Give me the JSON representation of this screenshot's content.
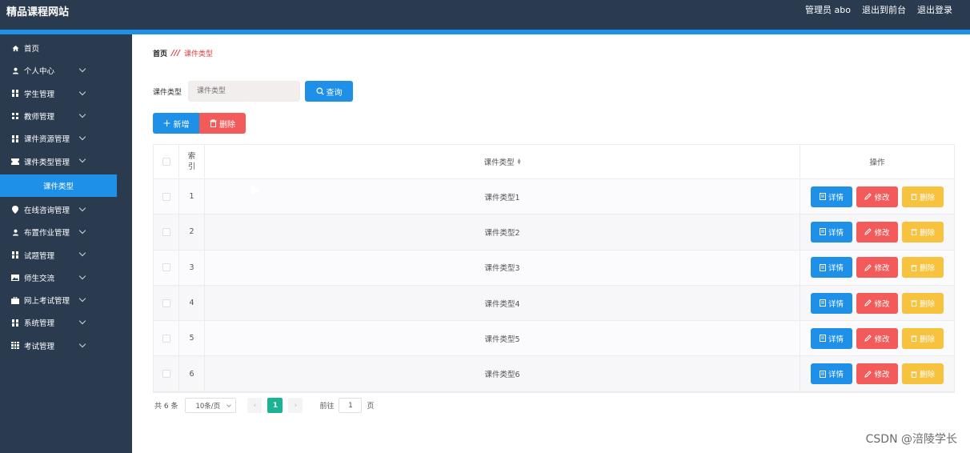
{
  "header": {
    "site_title": "精品课程网站",
    "admin_label": "管理员 abo",
    "to_front": "退出到前台",
    "logout": "退出登录"
  },
  "sidebar": {
    "items": [
      {
        "label": "首页",
        "icon": "home-icon",
        "has_children": false
      },
      {
        "label": "个人中心",
        "icon": "user-icon",
        "has_children": true
      },
      {
        "label": "学生管理",
        "icon": "grid-icon",
        "has_children": true
      },
      {
        "label": "教师管理",
        "icon": "grid-icon",
        "has_children": true
      },
      {
        "label": "课件资源管理",
        "icon": "grid-icon",
        "has_children": true
      },
      {
        "label": "课件类型管理",
        "icon": "ticket-icon",
        "has_children": true
      }
    ],
    "active_sub": "课件类型",
    "items_after": [
      {
        "label": "在线咨询管理",
        "icon": "location-pin-icon"
      },
      {
        "label": "布置作业管理",
        "icon": "user-icon"
      },
      {
        "label": "试题管理",
        "icon": "grid-icon"
      },
      {
        "label": "师生交流",
        "icon": "image-icon"
      },
      {
        "label": "网上考试管理",
        "icon": "briefcase-icon"
      },
      {
        "label": "系统管理",
        "icon": "grid-icon"
      },
      {
        "label": "考试管理",
        "icon": "grid9-icon"
      }
    ]
  },
  "breadcrumb": {
    "home": "首页",
    "separator": "///",
    "current": "课件类型"
  },
  "search": {
    "label": "课件类型",
    "placeholder": "课件类型",
    "query_button": "查询"
  },
  "actions": {
    "add_button": "新增",
    "delete_button": "删除"
  },
  "table": {
    "headers": {
      "index": "索引",
      "type": "课件类型",
      "ops": "操作"
    },
    "rows": [
      {
        "index": "1",
        "type": "课件类型1"
      },
      {
        "index": "2",
        "type": "课件类型2"
      },
      {
        "index": "3",
        "type": "课件类型3"
      },
      {
        "index": "4",
        "type": "课件类型4"
      },
      {
        "index": "5",
        "type": "课件类型5"
      },
      {
        "index": "6",
        "type": "课件类型6"
      }
    ],
    "row_buttons": {
      "detail": "详情",
      "edit": "修改",
      "delete": "删除"
    }
  },
  "pager": {
    "total": "共 6 条",
    "page_size": "10条/页",
    "current_page": "1",
    "goto_label": "前往",
    "goto_value": "1",
    "goto_unit": "页"
  },
  "watermark": "CSDN @涪陵学长",
  "colors": {
    "header_bg": "#2a3a4f",
    "primary": "#1e90e8",
    "danger": "#f35b5b",
    "warning": "#f7c23e",
    "pager_active": "#1ab394"
  }
}
